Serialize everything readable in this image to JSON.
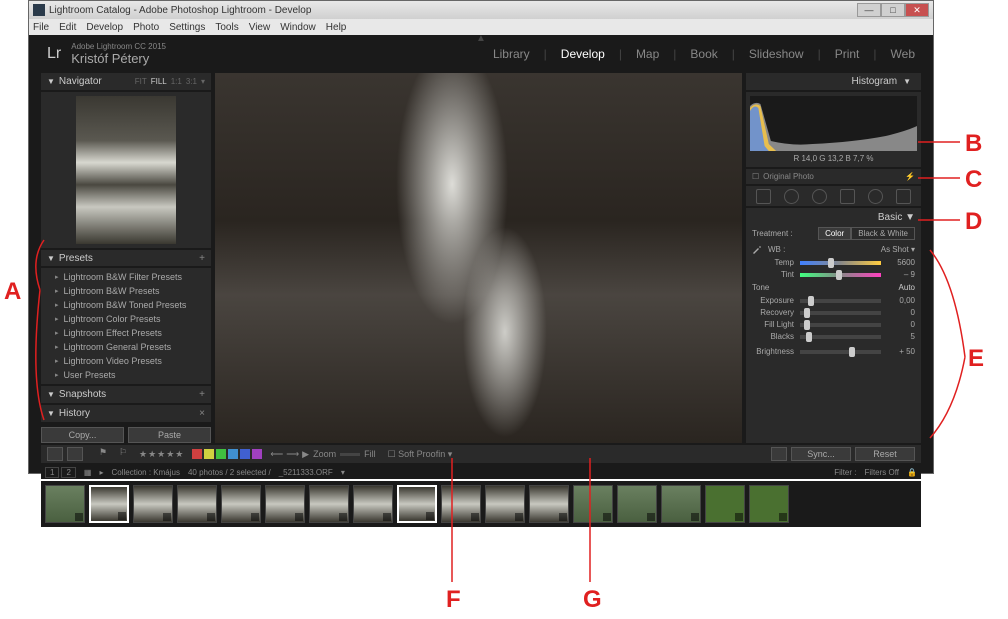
{
  "window": {
    "title": "Lightroom Catalog - Adobe Photoshop Lightroom - Develop"
  },
  "menubar": [
    "File",
    "Edit",
    "Develop",
    "Photo",
    "Settings",
    "Tools",
    "View",
    "Window",
    "Help"
  ],
  "header": {
    "product": "Adobe Lightroom CC 2015",
    "user": "Kristóf Pétery",
    "logo": "Lr"
  },
  "modules": [
    "Library",
    "Develop",
    "Map",
    "Book",
    "Slideshow",
    "Print",
    "Web"
  ],
  "active_module": "Develop",
  "navigator": {
    "title": "Navigator",
    "options": [
      "FIT",
      "FILL",
      "1:1",
      "3:1"
    ],
    "active": "FILL"
  },
  "presets": {
    "title": "Presets",
    "items": [
      "Lightroom B&W Filter Presets",
      "Lightroom B&W Presets",
      "Lightroom B&W Toned Presets",
      "Lightroom Color Presets",
      "Lightroom Effect Presets",
      "Lightroom General Presets",
      "Lightroom Video Presets",
      "User Presets"
    ]
  },
  "snapshots": {
    "title": "Snapshots"
  },
  "history": {
    "title": "History"
  },
  "copy_btn": "Copy...",
  "paste_btn": "Paste",
  "histogram": {
    "title": "Histogram",
    "rgb": "R  14,0   G  13,2   B   7,7  %",
    "original": "Original Photo"
  },
  "basic": {
    "title": "Basic",
    "treatment_lbl": "Treatment :",
    "color": "Color",
    "bw": "Black & White",
    "wb_lbl": "WB :",
    "wb_val": "As Shot",
    "temp_lbl": "Temp",
    "temp_val": "5600",
    "tint_lbl": "Tint",
    "tint_val": "– 9",
    "tone_lbl": "Tone",
    "auto": "Auto",
    "exposure_lbl": "Exposure",
    "exposure_val": "0,00",
    "recovery_lbl": "Recovery",
    "recovery_val": "0",
    "fill_lbl": "Fill Light",
    "fill_val": "0",
    "blacks_lbl": "Blacks",
    "blacks_val": "5",
    "brightness_lbl": "Brightness",
    "brightness_val": "+ 50"
  },
  "toolbar": {
    "zoom": "Zoom",
    "fill": "Fill",
    "soft_proof": "Soft Proofin",
    "sync": "Sync...",
    "reset": "Reset"
  },
  "filmstrip": {
    "pages": [
      "1",
      "2"
    ],
    "collection": "Collection : Kmájus",
    "count": "40 photos / 2 selected /",
    "filename": "_5211333.ORF",
    "filter_lbl": "Filter :",
    "filter_val": "Filters Off"
  },
  "colors": {
    "red": "#d04040",
    "yellow": "#d0d040",
    "green": "#40c040",
    "blue1": "#4060d0",
    "blue2": "#4090d0",
    "purple": "#a040c0"
  },
  "annotations": {
    "A": "A",
    "B": "B",
    "C": "C",
    "D": "D",
    "E": "E",
    "F": "F",
    "G": "G"
  }
}
